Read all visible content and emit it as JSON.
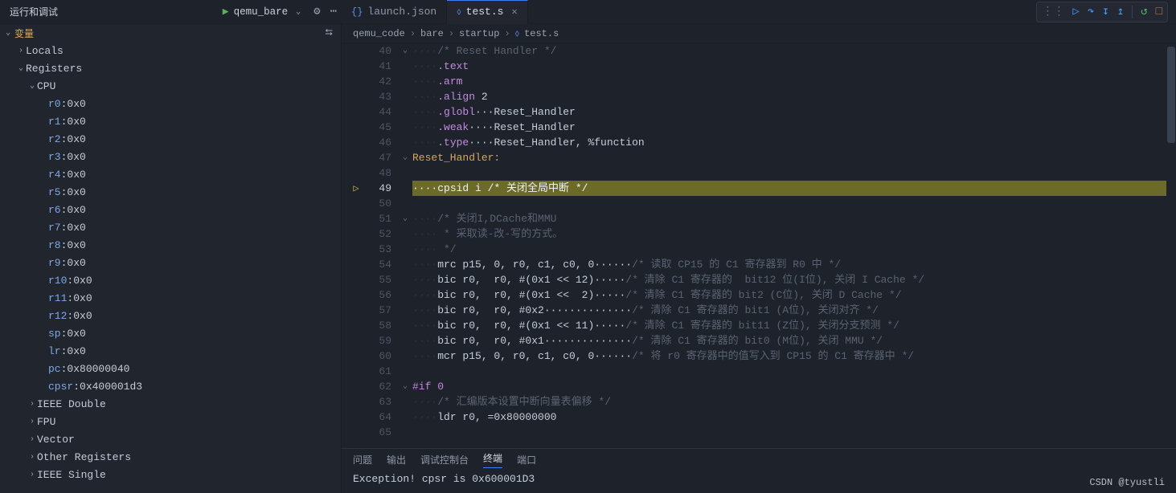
{
  "topbar": {
    "title": "运行和调试",
    "play_icon": "▶",
    "launch_config": "qemu_bare",
    "chevron": "⌄",
    "gear": "⚙",
    "dots": "⋯"
  },
  "tabs": [
    {
      "icon": "{}",
      "icon_name": "braces-icon",
      "label": "launch.json",
      "active": false,
      "closable": false
    },
    {
      "icon": "⬨",
      "icon_name": "asm-file-icon",
      "label": "test.s",
      "active": true,
      "closable": true
    }
  ],
  "debug_toolbar": {
    "handle": "⋮⋮",
    "continue": "▷",
    "step_over": "↷",
    "step_into": "↧",
    "step_out": "↥",
    "restart": "↺",
    "stop": "□"
  },
  "breadcrumb": {
    "segments": [
      "qemu_code",
      "bare",
      "startup"
    ],
    "file_icon": "⬨",
    "file": "test.s",
    "sep": "›"
  },
  "variables": {
    "header": "变量",
    "collapse_icon": "⮀",
    "sections": [
      {
        "label": "Locals",
        "expanded": false
      },
      {
        "label": "Registers",
        "expanded": true,
        "children": [
          {
            "label": "CPU",
            "expanded": true,
            "registers": [
              {
                "name": "r0",
                "value": "0x0"
              },
              {
                "name": "r1",
                "value": "0x0"
              },
              {
                "name": "r2",
                "value": "0x0"
              },
              {
                "name": "r3",
                "value": "0x0"
              },
              {
                "name": "r4",
                "value": "0x0"
              },
              {
                "name": "r5",
                "value": "0x0"
              },
              {
                "name": "r6",
                "value": "0x0"
              },
              {
                "name": "r7",
                "value": "0x0"
              },
              {
                "name": "r8",
                "value": "0x0"
              },
              {
                "name": "r9",
                "value": "0x0"
              },
              {
                "name": "r10",
                "value": "0x0"
              },
              {
                "name": "r11",
                "value": "0x0"
              },
              {
                "name": "r12",
                "value": "0x0"
              },
              {
                "name": "sp",
                "value": "0x0"
              },
              {
                "name": "lr",
                "value": "0x0"
              },
              {
                "name": "pc",
                "value": "0x80000040"
              },
              {
                "name": "cpsr",
                "value": "0x400001d3"
              }
            ]
          },
          {
            "label": "IEEE Double",
            "expanded": false
          },
          {
            "label": "FPU",
            "expanded": false
          },
          {
            "label": "Vector",
            "expanded": false
          },
          {
            "label": "Other Registers",
            "expanded": false
          },
          {
            "label": "IEEE Single",
            "expanded": false
          }
        ]
      }
    ]
  },
  "editor": {
    "current_line": 49,
    "fold_markers": {
      "40": "⌄",
      "47": "⌄",
      "51": "⌄",
      "62": "⌄"
    },
    "lines": [
      {
        "n": 40,
        "ws": "····",
        "html": "<span class='cmt'>/* Reset Handler */</span>"
      },
      {
        "n": 41,
        "ws": "····",
        "html": "<span class='kw'>.text</span>"
      },
      {
        "n": 42,
        "ws": "····",
        "html": "<span class='kw'>.arm</span>"
      },
      {
        "n": 43,
        "ws": "····",
        "html": "<span class='kw'>.align</span> <span class='num'>2</span>"
      },
      {
        "n": 44,
        "ws": "····",
        "html": "<span class='kw'>.globl</span>···Reset_Handler"
      },
      {
        "n": 45,
        "ws": "····",
        "html": "<span class='kw'>.weak</span>····Reset_Handler"
      },
      {
        "n": 46,
        "ws": "····",
        "html": "<span class='kw'>.type</span>····Reset_Handler, %function"
      },
      {
        "n": 47,
        "ws": "",
        "html": "<span class='lbl'>Reset_Handler:</span>"
      },
      {
        "n": 48,
        "ws": "",
        "html": ""
      },
      {
        "n": 49,
        "ws": "····",
        "html": "cpsid i <span class='cmt'>/* 关闭全局中断 */</span>"
      },
      {
        "n": 50,
        "ws": "",
        "html": ""
      },
      {
        "n": 51,
        "ws": "····",
        "html": "<span class='cmt'>/* 关闭I,DCache和MMU</span>"
      },
      {
        "n": 52,
        "ws": "···· ",
        "html": "<span class='cmt'>* 采取读-改-写的方式。</span>"
      },
      {
        "n": 53,
        "ws": "···· ",
        "html": "<span class='cmt'>*/</span>"
      },
      {
        "n": 54,
        "ws": "····",
        "html": "mrc p15, 0, r0, c1, c0, 0······<span class='cmt'>/* 读取 CP15 的 C1 寄存器到 R0 中 */</span>"
      },
      {
        "n": 55,
        "ws": "····",
        "html": "bic r0,  r0, #(0x1 &lt;&lt; 12)·····<span class='cmt'>/* 清除 C1 寄存器的  bit12 位(I位), 关闭 I Cache */</span>"
      },
      {
        "n": 56,
        "ws": "····",
        "html": "bic r0,  r0, #(0x1 &lt;&lt;  2)·····<span class='cmt'>/* 清除 C1 寄存器的 bit2 (C位), 关闭 D Cache */</span>"
      },
      {
        "n": 57,
        "ws": "····",
        "html": "bic r0,  r0, #0x2··············<span class='cmt'>/* 清除 C1 寄存器的 bit1 (A位), 关闭对齐 */</span>"
      },
      {
        "n": 58,
        "ws": "····",
        "html": "bic r0,  r0, #(0x1 &lt;&lt; 11)·····<span class='cmt'>/* 清除 C1 寄存器的 bit11 (Z位), 关闭分支预测 */</span>"
      },
      {
        "n": 59,
        "ws": "····",
        "html": "bic r0,  r0, #0x1··············<span class='cmt'>/* 清除 C1 寄存器的 bit0 (M位), 关闭 MMU */</span>"
      },
      {
        "n": 60,
        "ws": "····",
        "html": "mcr p15, 0, r0, c1, c0, 0······<span class='cmt'>/* 将 r0 寄存器中的值写入到 CP15 的 C1 寄存器中 */</span>"
      },
      {
        "n": 61,
        "ws": "",
        "html": ""
      },
      {
        "n": 62,
        "ws": "",
        "html": "<span class='kw'>#if 0</span>"
      },
      {
        "n": 63,
        "ws": "····",
        "html": "<span class='cmt'>/* 汇编版本设置中断向量表偏移 */</span>"
      },
      {
        "n": 64,
        "ws": "····",
        "html": "ldr r0, =0x80000000"
      },
      {
        "n": 65,
        "ws": "",
        "html": ""
      }
    ]
  },
  "bottom": {
    "tabs": [
      "问题",
      "输出",
      "调试控制台",
      "终端",
      "端口"
    ],
    "active_tab": 3,
    "output": "Exception! cpsr is 0x600001D3"
  },
  "watermark": "CSDN @tyustli"
}
